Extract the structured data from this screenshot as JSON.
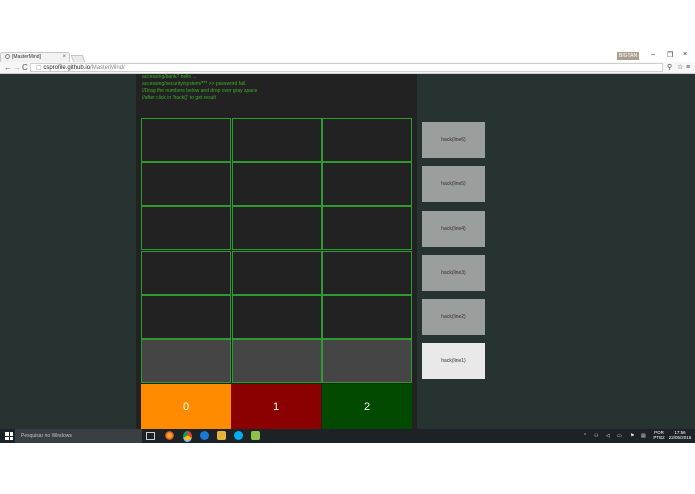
{
  "browser": {
    "tab_title": "[MasterMind]",
    "tab_close": "×",
    "user_badge": "BIGTAN",
    "win_minimize": "–",
    "win_maximize": "❐",
    "win_close": "×",
    "back": "←",
    "forward": "→",
    "reload": "C",
    "url_host": "csprofile.github.io",
    "url_path": "/MasterMind/",
    "menu": "≡"
  },
  "console": {
    "lines": [
      "accessing/bank? hello ...",
      "accessing/security/system/*** >> password fail.",
      "//Drag the numbers below and drop over gray space",
      "//after click in 'hack()' to get result"
    ]
  },
  "grid": {
    "rows": 6,
    "cols": 3,
    "current_row": 5
  },
  "color_buttons": [
    {
      "label": "0",
      "color": "#ff8c00"
    },
    {
      "label": "1",
      "color": "#8b0000"
    },
    {
      "label": "2",
      "color": "#014a00"
    }
  ],
  "hack_buttons": [
    {
      "label": "hack(line6)",
      "active": false
    },
    {
      "label": "hack(line5)",
      "active": false
    },
    {
      "label": "hack(line4)",
      "active": false
    },
    {
      "label": "hack(line3)",
      "active": false
    },
    {
      "label": "hack(line2)",
      "active": false
    },
    {
      "label": "hack(line1)",
      "active": true
    }
  ],
  "taskbar": {
    "search_placeholder": "Pesquisar no Windows",
    "tray_lang": "POR",
    "tray_layout": "PTB2",
    "time": "17:56",
    "date": "22/05/2016"
  },
  "colors": {
    "page_bg": "#263331",
    "game_bg": "#222222",
    "grid_line": "#2e9b30",
    "console_text": "#3fae2a",
    "current_row": "#454545"
  }
}
